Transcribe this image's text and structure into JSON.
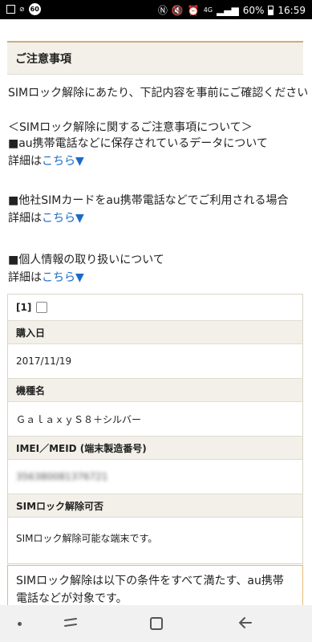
{
  "status_bar": {
    "badge": "60",
    "battery": "60%",
    "time": "16:59",
    "network": "4G"
  },
  "page": {
    "section_title": "ご注意事項",
    "intro": "SIMロック解除にあたり、下記内容を事前にご確認ください",
    "notes_heading": "＜SIMロック解除に関するご注意事項について＞",
    "items": [
      {
        "title": "■au携帯電話などに保存されているデータについて",
        "detail_prefix": "詳細は",
        "detail_link": "こちら▼"
      },
      {
        "title": "■他社SIMカードをau携帯電話などでご利用される場合",
        "detail_prefix": "詳細は",
        "detail_link": "こちら▼"
      },
      {
        "title": "■個人情報の取り扱いについて",
        "detail_prefix": "詳細は",
        "detail_link": "こちら▼"
      }
    ]
  },
  "device_card": {
    "index_label": "[1]",
    "purchase_date_label": "購入日",
    "purchase_date": "2017/11/19",
    "model_label": "機種名",
    "model": "ＧａｌａｘｙＳ８＋シルバー",
    "imei_label": "IMEI／MEID (端末製造番号)",
    "imei_value": "356380081376721",
    "unlock_label": "SIMロック解除可否",
    "unlock_value": "SIMロック解除可能な端末です。"
  },
  "notice": {
    "text": "SIMロック解除は以下の条件をすべて満たす、au携帯電話などが対象です。"
  },
  "colors": {
    "link": "#1a6bc8",
    "header_bg": "#f2f0e8",
    "notice_border": "#e5b978"
  }
}
